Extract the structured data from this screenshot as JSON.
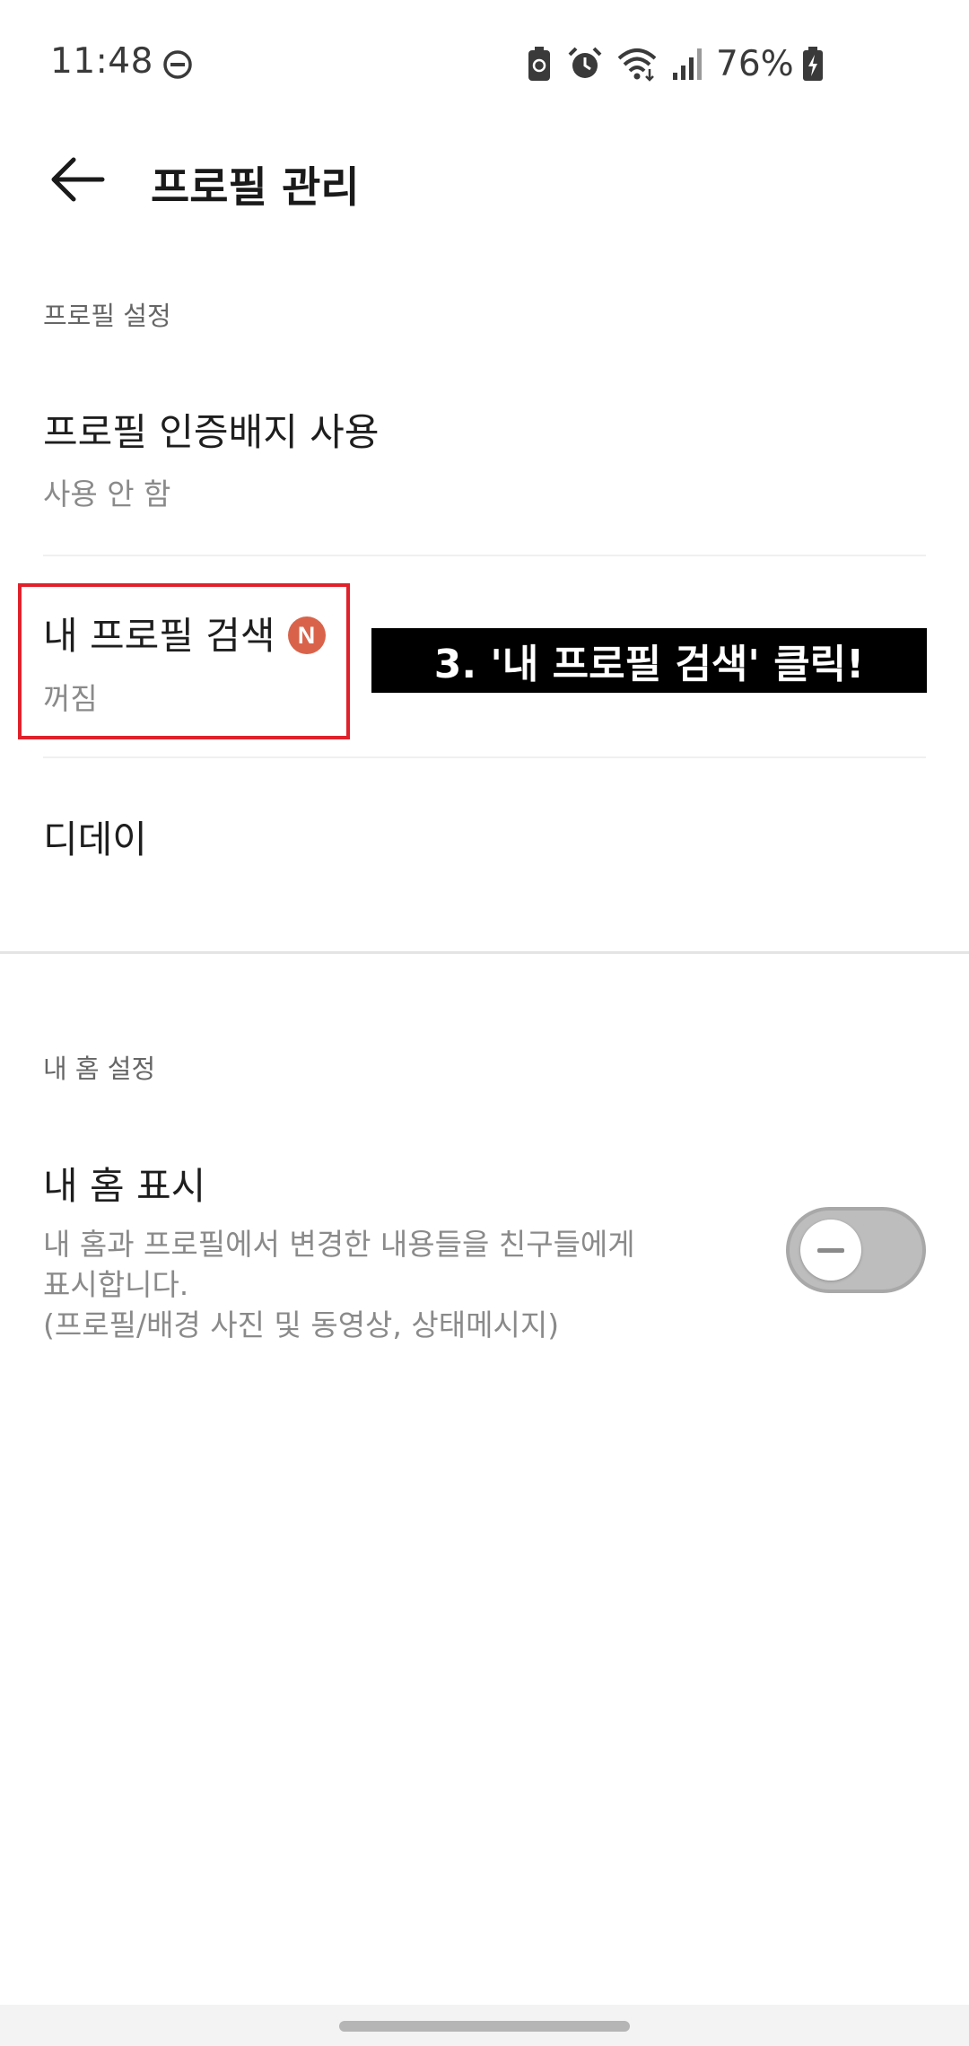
{
  "status_bar": {
    "time": "11:48",
    "battery_percent": "76%"
  },
  "header": {
    "title": "프로필 관리"
  },
  "sections": {
    "profile_settings": {
      "header": "프로필 설정",
      "items": [
        {
          "title": "프로필 인증배지 사용",
          "subtitle": "사용 안 함"
        },
        {
          "title": "내 프로필 검색",
          "badge": "N",
          "subtitle": "꺼짐"
        },
        {
          "title": "디데이"
        }
      ]
    },
    "home_settings": {
      "header": "내 홈 설정",
      "items": [
        {
          "title": "내 홈 표시",
          "description_lines": [
            "내 홈과 프로필에서 변경한 내용들을 친구들에게",
            "표시합니다.",
            "(프로필/배경 사진 및 동영상, 상태메시지)"
          ],
          "toggle_on": false
        }
      ]
    }
  },
  "annotation": {
    "text": "3. '내 프로필 검색' 클릭!",
    "box_color": "#e0212b"
  },
  "colors": {
    "badge": "#d9634a",
    "toggle_off": "#bdbdbd"
  }
}
